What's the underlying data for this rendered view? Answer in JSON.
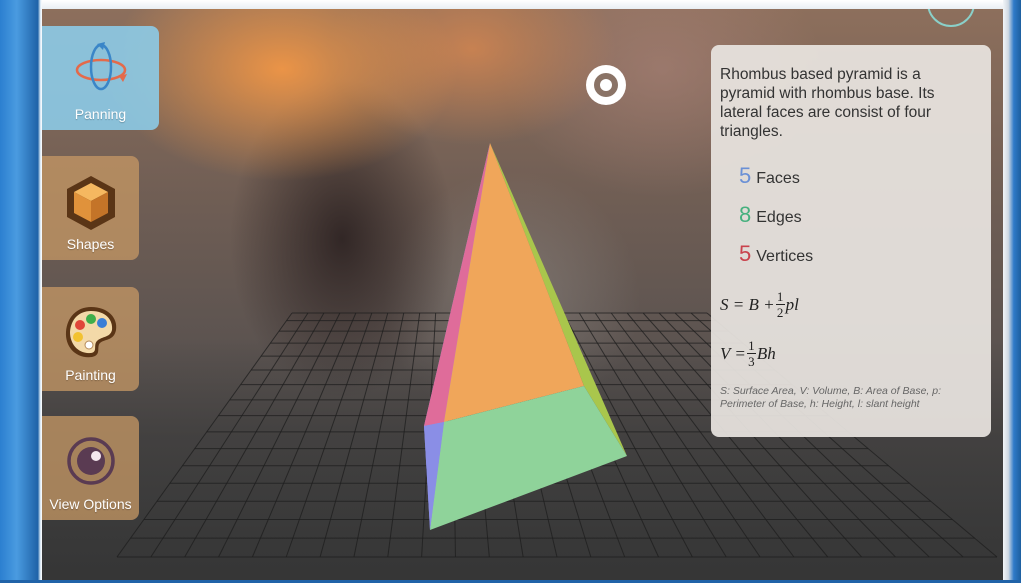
{
  "toolbar": {
    "panning_label": "Panning",
    "shapes_label": "Shapes",
    "painting_label": "Painting",
    "view_options_label": "View Options"
  },
  "info_panel": {
    "description": "Rhombus based pyramid is a pyramid with rhombus base. Its lateral faces are consist of four triangles.",
    "faces_count": "5",
    "faces_label": "Faces",
    "edges_count": "8",
    "edges_label": "Edges",
    "vertices_count": "5",
    "vertices_label": "Vertices",
    "surface_formula": {
      "lhs": "S = B +",
      "num": "1",
      "den": "2",
      "rest": "pl"
    },
    "volume_formula": {
      "lhs": "V =",
      "num": "1",
      "den": "3",
      "rest": "Bh"
    },
    "legend": "S: Surface Area, V: Volume, B: Area of Base, p: Perimeter of Base, h: Height, l: slant height"
  },
  "colors": {
    "faces": "#6a90d6",
    "edges": "#46b07e",
    "vertices": "#c9424c",
    "pyramid_front": "#f0a65a",
    "pyramid_left": "#df6c9a",
    "pyramid_right": "#a9c64c",
    "pyramid_base": "#8fd39a",
    "pyramid_base_left": "#8a8ee6"
  },
  "icons": {
    "panning": "rotate-arrows-icon",
    "shapes": "cube-icon",
    "painting": "palette-icon",
    "view_options": "eye-icon",
    "reticle": "target-reticle-icon"
  }
}
